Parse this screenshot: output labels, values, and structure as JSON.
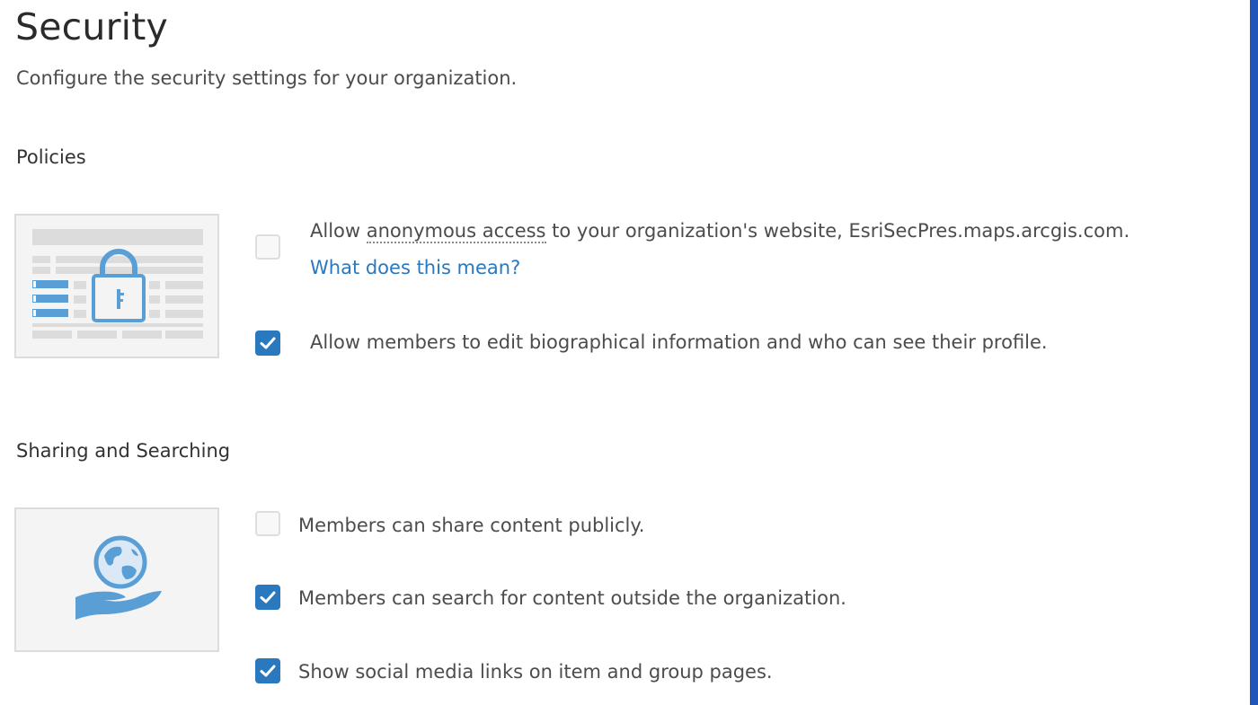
{
  "page": {
    "title": "Security",
    "subtitle": "Configure the security settings for your organization."
  },
  "policies": {
    "heading": "Policies",
    "illustration_icon": "lock-document-icon",
    "options": [
      {
        "checked": false,
        "prefix": "Allow ",
        "term": "anonymous access",
        "suffix": " to your organization's website, EsriSecPres.maps.arcgis.com.",
        "link": "What does this mean?"
      },
      {
        "checked": true,
        "label": "Allow members to edit biographical information and who can see their profile."
      }
    ]
  },
  "sharing": {
    "heading": "Sharing and Searching",
    "illustration_icon": "globe-in-hand-icon",
    "options": [
      {
        "checked": false,
        "label": "Members can share content publicly."
      },
      {
        "checked": true,
        "label": "Members can search for content outside the organization."
      },
      {
        "checked": true,
        "label": "Show social media links on item and group pages."
      }
    ]
  },
  "colors": {
    "accent": "#2a78bd",
    "illustration_blue": "#5a9ed6",
    "text": "#4c4c4c",
    "right_bar": "#1f56b8"
  }
}
